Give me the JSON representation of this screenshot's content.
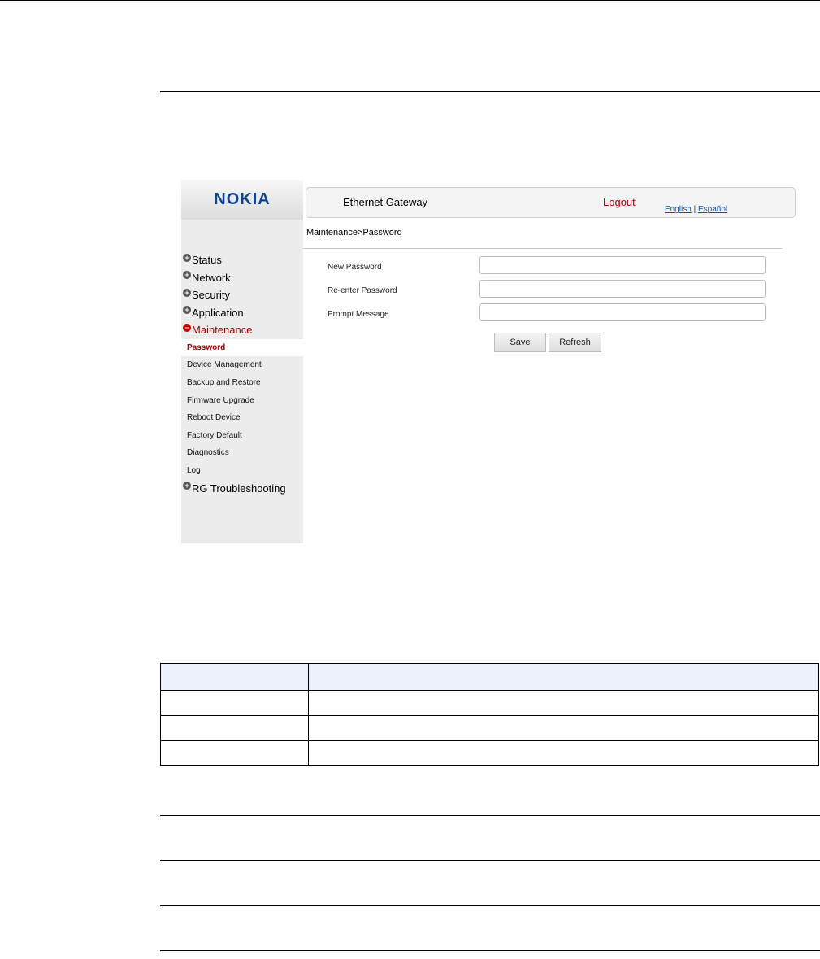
{
  "brand": {
    "logo_text": "NOKIA",
    "logo_color": "#124191"
  },
  "header": {
    "app_title": "Ethernet Gateway",
    "logout_label": "Logout",
    "lang_english": "English",
    "lang_separator": "|",
    "lang_spanish": "Español"
  },
  "breadcrumb": "Maintenance>Password",
  "sidebar": {
    "groups": [
      {
        "label": "Status"
      },
      {
        "label": "Network"
      },
      {
        "label": "Security"
      },
      {
        "label": "Application"
      },
      {
        "label": "Maintenance"
      }
    ],
    "maintenance_items": [
      {
        "label": "Password"
      },
      {
        "label": "Device Management"
      },
      {
        "label": "Backup and Restore"
      },
      {
        "label": "Firmware Upgrade"
      },
      {
        "label": "Reboot Device"
      },
      {
        "label": "Factory Default"
      },
      {
        "label": "Diagnostics"
      },
      {
        "label": "Log"
      }
    ],
    "last_group": {
      "label": "RG Troubleshooting"
    }
  },
  "form": {
    "new_password_label": "New Password",
    "new_password_value": "",
    "reenter_label": "Re-enter Password",
    "reenter_value": "",
    "prompt_label": "Prompt Message",
    "prompt_value": "",
    "save_label": "Save",
    "refresh_label": "Refresh"
  },
  "colors": {
    "active_red": "#a40000",
    "table_header_bg": "#edf1fb"
  },
  "doc_table": {
    "header": [
      "",
      ""
    ],
    "rows": [
      [
        "",
        ""
      ],
      [
        "",
        ""
      ],
      [
        "",
        ""
      ]
    ]
  }
}
